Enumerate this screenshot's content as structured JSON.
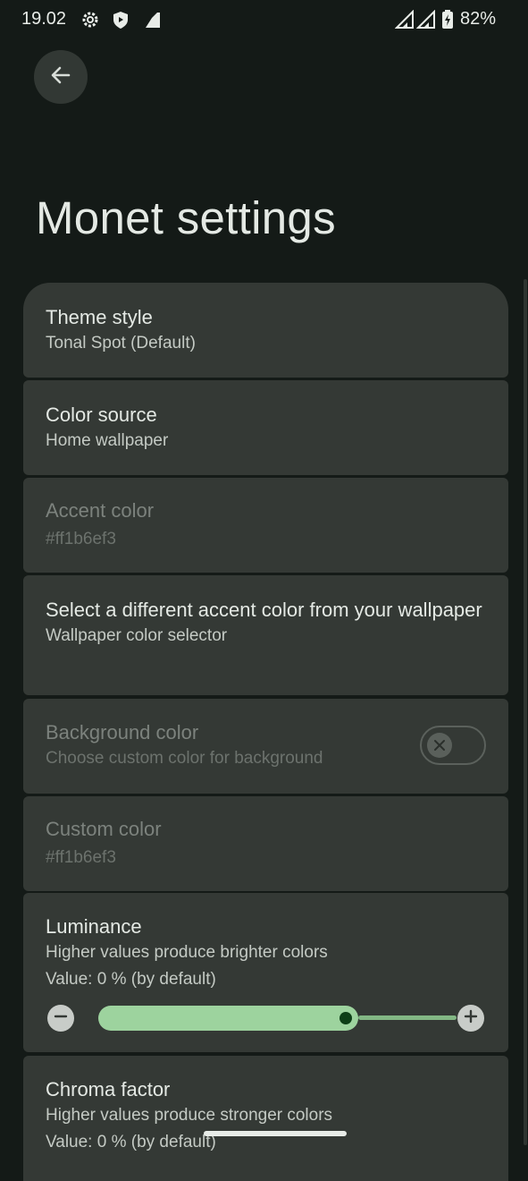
{
  "status_bar": {
    "time": "19.02",
    "battery_percent": "82%",
    "icons": [
      "gear-icon",
      "shield-icon",
      "signal-icon",
      "signal-icon",
      "signal-icon",
      "battery-charging-icon"
    ]
  },
  "header": {
    "back_icon": "arrow-left-icon",
    "title": "Monet settings"
  },
  "settings": {
    "theme_style": {
      "title": "Theme style",
      "summary": "Tonal Spot (Default)"
    },
    "color_source": {
      "title": "Color source",
      "summary": "Home wallpaper"
    },
    "accent_color": {
      "title": "Accent color",
      "summary": "#ff1b6ef3",
      "enabled": false
    },
    "wallpaper_accent": {
      "title": "Select a different accent color from your wallpaper",
      "summary": "Wallpaper color selector"
    },
    "background_color": {
      "title": "Background color",
      "summary": "Choose custom color for background",
      "enabled": false,
      "switch_on": false
    },
    "custom_color": {
      "title": "Custom color",
      "summary": "#ff1b6ef3",
      "enabled": false
    },
    "luminance": {
      "title": "Luminance",
      "summary": "Higher values produce brighter colors",
      "value_text": "Value: 0 % (by default)",
      "slider_fraction": 0.74
    },
    "chroma": {
      "title": "Chroma factor",
      "summary": "Higher values produce stronger colors",
      "value_text": "Value: 0 % (by default)"
    }
  },
  "colors": {
    "background": "#141a17",
    "card": "#343935",
    "slider_active": "#9dd39e",
    "slider_thumb": "#0e3f17"
  }
}
